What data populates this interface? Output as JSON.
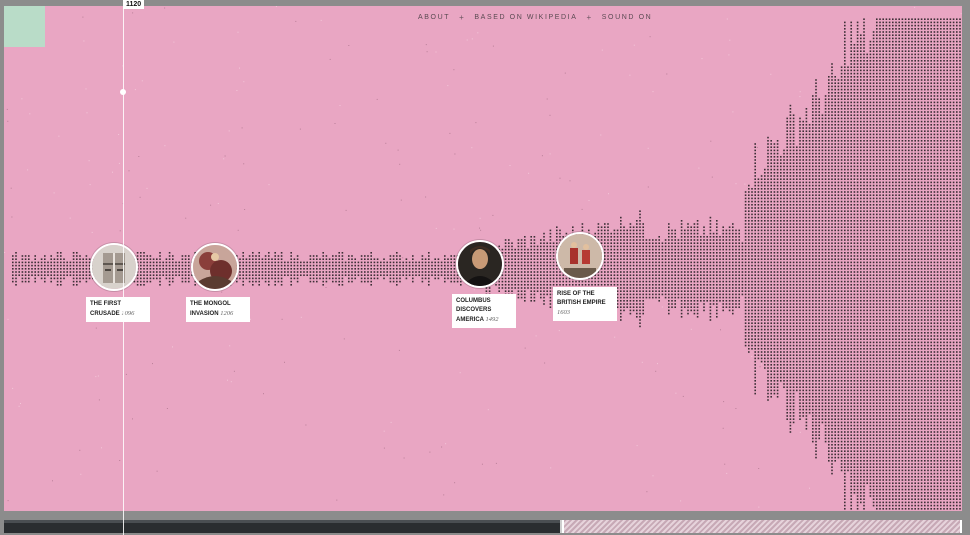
{
  "nav": {
    "about": "ABOUT",
    "wikipedia": "BASED ON WIKIPEDIA",
    "sound": "SOUND ON",
    "separator": "+"
  },
  "cursor": {
    "year": "1120"
  },
  "events": [
    {
      "title_line1": "THE FIRST",
      "title_line2": "CRUSADE",
      "year": "1096",
      "icon": "helmet-thumbnail"
    },
    {
      "title_line1": "THE MONGOL",
      "title_line2": "INVASION",
      "year": "1206",
      "icon": "mongol-thumbnail"
    },
    {
      "title_line1": "COLUMBUS",
      "title_line2": "DISCOVERS",
      "title_line3": "AMERICA",
      "year": "1492",
      "icon": "columbus-portrait-thumbnail"
    },
    {
      "title_line1": "RISE OF THE",
      "title_line2": "BRITISH EMPIRE",
      "year": "1603",
      "icon": "british-soldiers-thumbnail"
    }
  ],
  "colors": {
    "background": "#e9a6c3",
    "frame": "#8c8c8c",
    "corner": "#b9dcc8",
    "bars": "#3d2f36"
  },
  "timeline": {
    "window_fraction_start": 0.58,
    "window_fraction_end": 1.0
  }
}
